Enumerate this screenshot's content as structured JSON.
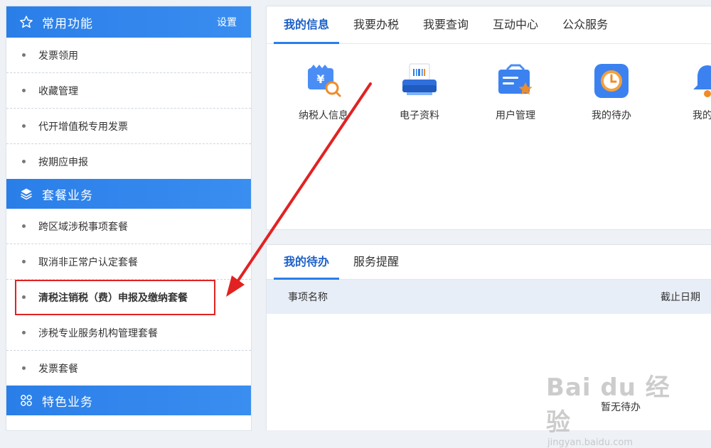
{
  "sidebar": {
    "common": {
      "title": "常用功能",
      "settings": "设置",
      "icon": "star-icon"
    },
    "common_items": [
      "发票领用",
      "收藏管理",
      "代开增值税专用发票",
      "按期应申报"
    ],
    "package": {
      "title": "套餐业务",
      "icon": "layers-icon"
    },
    "package_items": [
      "跨区域涉税事项套餐",
      "取消非正常户认定套餐",
      "清税注销税（费）申报及缴纳套餐",
      "涉税专业服务机构管理套餐",
      "发票套餐"
    ],
    "special": {
      "title": "特色业务",
      "icon": "grid-icon"
    }
  },
  "top_tabs": [
    "我的信息",
    "我要办税",
    "我要查询",
    "互动中心",
    "公众服务"
  ],
  "apps": [
    {
      "label": "纳税人信息",
      "icon": "taxpayer-info-icon"
    },
    {
      "label": "电子资料",
      "icon": "printer-icon"
    },
    {
      "label": "用户管理",
      "icon": "user-card-icon"
    },
    {
      "label": "我的待办",
      "icon": "clock-icon"
    },
    {
      "label": "我的提",
      "icon": "bell-icon"
    }
  ],
  "bottom_tabs": [
    "我的待办",
    "服务提醒"
  ],
  "todo_table": {
    "col_name": "事项名称",
    "col_deadline": "截止日期",
    "empty_text": "暂无待办"
  },
  "watermark": {
    "brand": "Bai du 经验",
    "url": "jingyan.baidu.com"
  },
  "colors": {
    "accent": "#2a7ee8",
    "highlight": "#e22222"
  }
}
